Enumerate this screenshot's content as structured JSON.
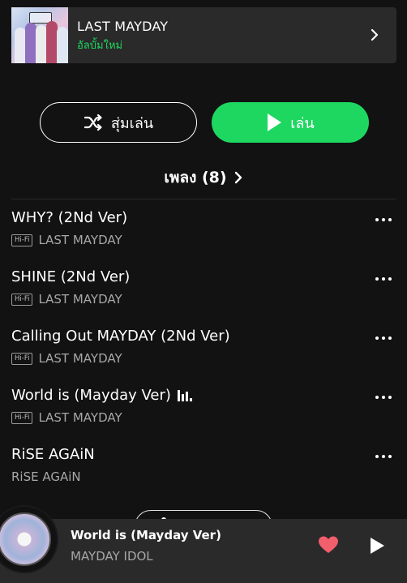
{
  "album": {
    "title": "LAST MAYDAY",
    "subtitle": "อัลบั้มใหม่"
  },
  "actions": {
    "shuffle_label": "สุ่มเล่น",
    "play_label": "เล่น"
  },
  "songs_header": {
    "label": "เพลง (8)"
  },
  "tracks": [
    {
      "title": "WHY? (2Nd Ver)",
      "artist": "LAST MAYDAY",
      "hifi": "Hi-Fi",
      "playing": false
    },
    {
      "title": "SHINE (2Nd Ver)",
      "artist": "LAST MAYDAY",
      "hifi": "Hi-Fi",
      "playing": false
    },
    {
      "title": "Calling Out MAYDAY (2Nd Ver)",
      "artist": "LAST MAYDAY",
      "hifi": "Hi-Fi",
      "playing": false
    },
    {
      "title": "World is (Mayday Ver)",
      "artist": "LAST MAYDAY",
      "hifi": "Hi-Fi",
      "playing": true
    },
    {
      "title": "RiSE AGAiN",
      "artist": "RiSE AGAiN",
      "hifi": "",
      "playing": false
    }
  ],
  "now_playing": {
    "title": "World is (Mayday Ver)",
    "artist": "MAYDAY IDOL",
    "liked": true
  },
  "colors": {
    "accent": "#1ed760",
    "like": "#f15e6c",
    "background": "#121212",
    "card": "#2a2a2a"
  }
}
